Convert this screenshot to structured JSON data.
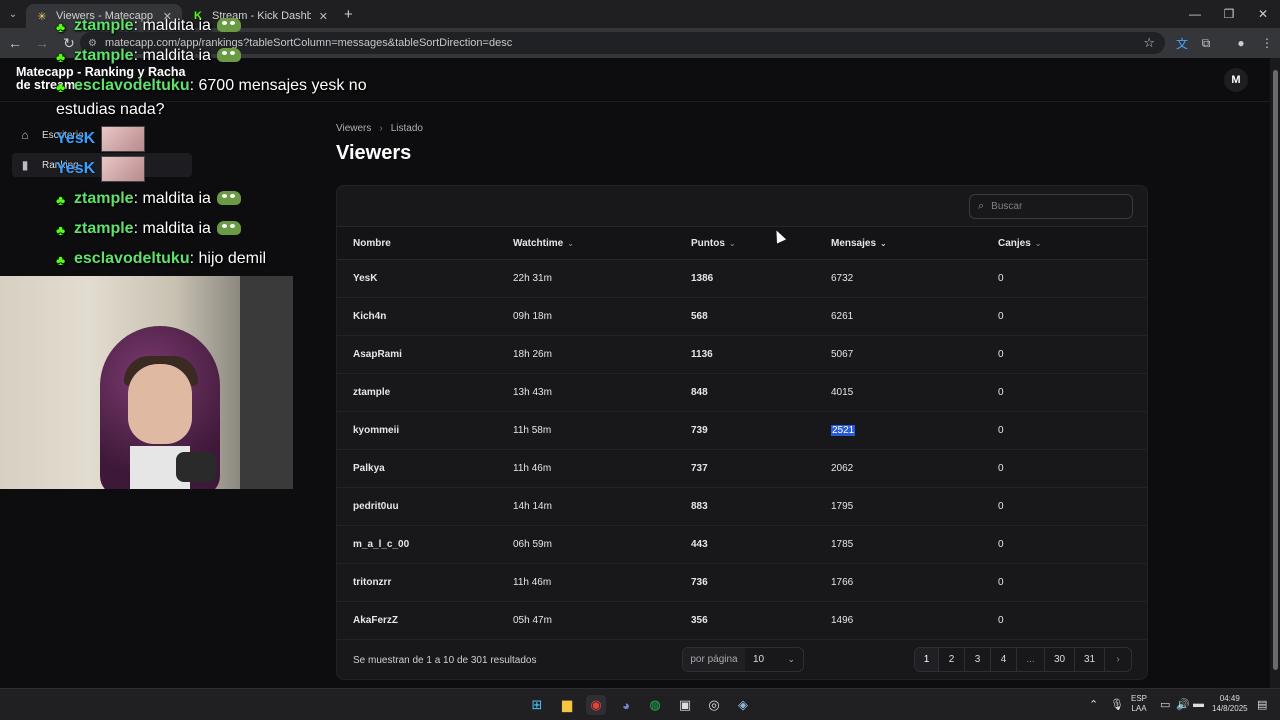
{
  "browser": {
    "tabs": [
      {
        "title": "Viewers - Matecapp - Ranking",
        "active": true
      },
      {
        "title": "Stream - Kick Dashboard",
        "active": false
      }
    ],
    "url": "matecapp.com/app/rankings?tableSortColumn=messages&tableSortDirection=desc"
  },
  "app": {
    "title_line1": "Matecapp - Ranking y Racha",
    "title_line2": "de streams",
    "avatar_initial": "M"
  },
  "sidebar": {
    "items": [
      {
        "label": "Escritorio",
        "icon": "home-icon"
      },
      {
        "label": "Ranking",
        "icon": "bar-chart-icon"
      }
    ]
  },
  "chat": {
    "messages": [
      {
        "user": "ztample",
        "text": "maldita ia"
      },
      {
        "user": "ztample",
        "text": "maldita ia"
      },
      {
        "user": "esclavodeltuku",
        "text": "6700 mensajes yesk no"
      },
      {
        "user": "",
        "text": "estudias nada?"
      },
      {
        "user": "YesK",
        "text": ""
      },
      {
        "user": "YesK",
        "text": ""
      },
      {
        "user": "ztample",
        "text": "maldita ia"
      },
      {
        "user": "ztample",
        "text": "maldita ia"
      },
      {
        "user": "esclavodeltuku",
        "text": "hijo demil"
      }
    ]
  },
  "page": {
    "breadcrumb": [
      "Viewers",
      "Listado"
    ],
    "title": "Viewers",
    "search_placeholder": "Buscar"
  },
  "table": {
    "columns": [
      "Nombre",
      "Watchtime",
      "Puntos",
      "Mensajes",
      "Canjes"
    ],
    "rows": [
      [
        "YesK",
        "22h 31m",
        "1386",
        "6732",
        "0"
      ],
      [
        "Kich4n",
        "09h 18m",
        "568",
        "6261",
        "0"
      ],
      [
        "AsapRami",
        "18h 26m",
        "1136",
        "5067",
        "0"
      ],
      [
        "ztample",
        "13h 43m",
        "848",
        "4015",
        "0"
      ],
      [
        "kyommeii",
        "11h 58m",
        "739",
        "2521",
        "0"
      ],
      [
        "Palkya",
        "11h 46m",
        "737",
        "2062",
        "0"
      ],
      [
        "pedrit0uu",
        "14h 14m",
        "883",
        "1795",
        "0"
      ],
      [
        "m_a_l_c_00",
        "06h 59m",
        "443",
        "1785",
        "0"
      ],
      [
        "tritonzrr",
        "11h 46m",
        "736",
        "1766",
        "0"
      ],
      [
        "AkaFerzZ",
        "05h 47m",
        "356",
        "1496",
        "0"
      ]
    ]
  },
  "footer": {
    "results_text": "Se muestran de 1 a 10 de 301 resultados",
    "per_page_label": "por página",
    "per_page_value": "10",
    "pages": [
      "1",
      "2",
      "3",
      "4",
      "...",
      "30",
      "31",
      "›"
    ]
  },
  "taskbar": {
    "lang_line1": "ESP",
    "lang_line2": "LAA",
    "time": "04:49",
    "date": "14/8/2025"
  }
}
